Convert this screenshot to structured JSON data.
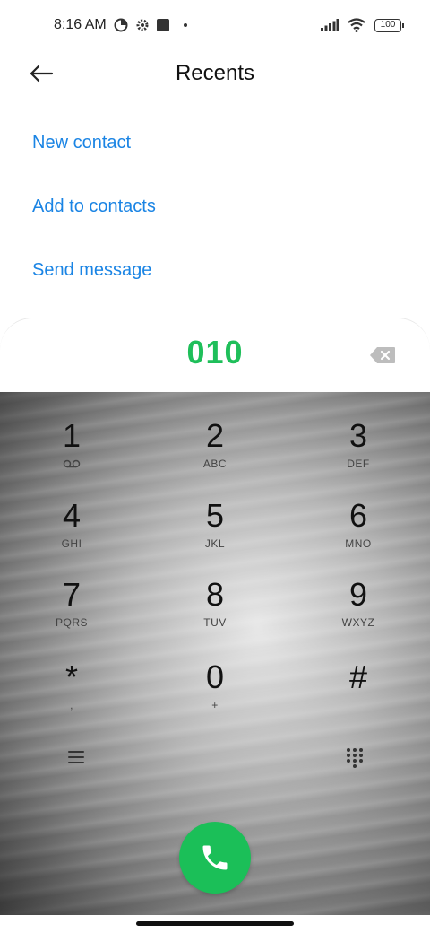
{
  "status_bar": {
    "time": "8:16 AM",
    "battery": "100"
  },
  "header": {
    "title": "Recents"
  },
  "actions": {
    "new_contact": "New contact",
    "add_to_contacts": "Add to contacts",
    "send_message": "Send message"
  },
  "dialer": {
    "number": "010"
  },
  "keypad": [
    {
      "digit": "1",
      "letters": ""
    },
    {
      "digit": "2",
      "letters": "ABC"
    },
    {
      "digit": "3",
      "letters": "DEF"
    },
    {
      "digit": "4",
      "letters": "GHI"
    },
    {
      "digit": "5",
      "letters": "JKL"
    },
    {
      "digit": "6",
      "letters": "MNO"
    },
    {
      "digit": "7",
      "letters": "PQRS"
    },
    {
      "digit": "8",
      "letters": "TUV"
    },
    {
      "digit": "9",
      "letters": "WXYZ"
    },
    {
      "digit": "*",
      "letters": ","
    },
    {
      "digit": "0",
      "letters": "+"
    },
    {
      "digit": "#",
      "letters": ""
    }
  ],
  "icons": {
    "back": "back-arrow-icon",
    "backspace": "backspace-icon",
    "voicemail": "voicemail-icon",
    "menu": "menu-icon",
    "dialpad": "dialpad-icon",
    "call": "phone-icon"
  },
  "colors": {
    "accent": "#1a84e4",
    "number": "#1fbf5a",
    "call_button": "#1bbf58"
  }
}
